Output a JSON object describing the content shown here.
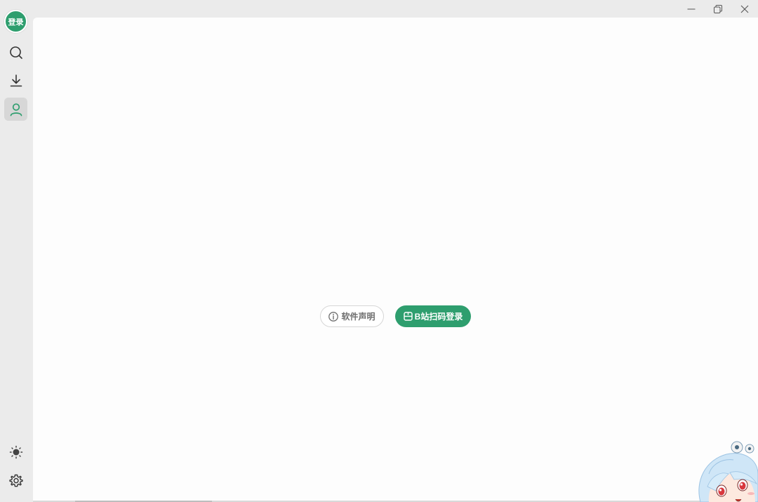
{
  "sidebar": {
    "avatar_label": "登录",
    "items": [
      {
        "name": "search",
        "icon": "search-icon"
      },
      {
        "name": "download",
        "icon": "download-icon"
      },
      {
        "name": "user",
        "icon": "user-icon",
        "active": true
      }
    ],
    "bottom_items": [
      {
        "name": "theme",
        "icon": "sun-icon"
      },
      {
        "name": "settings",
        "icon": "gear-icon"
      }
    ]
  },
  "window_controls": {
    "minimize": "minimize-icon",
    "restore": "restore-icon",
    "close": "close-icon"
  },
  "main": {
    "disclaimer_label": "软件声明",
    "login_label": "B站扫码登录"
  },
  "colors": {
    "accent": "#2e9e6e",
    "sidebar_bg": "#ebebeb",
    "content_bg": "#fdfdfd",
    "active_bg": "#d7d7d7"
  }
}
